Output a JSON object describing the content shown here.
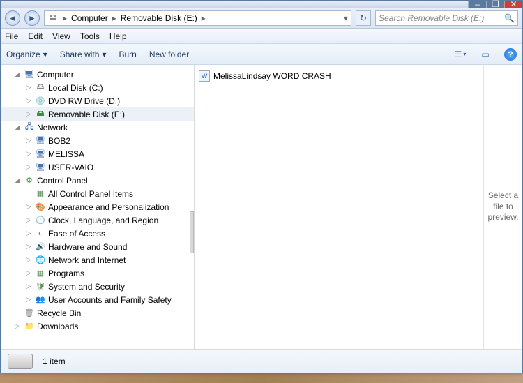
{
  "title_controls": {
    "min": "–",
    "max": "❐",
    "close": "✕"
  },
  "nav": {
    "back": "◄",
    "fwd": "►",
    "refresh": "↻"
  },
  "breadcrumb": {
    "root": "Computer",
    "loc": "Removable Disk (E:)",
    "drive_icon": "🖴"
  },
  "search": {
    "placeholder": "Search Removable Disk (E:)",
    "icon": "🔍"
  },
  "menu": [
    "File",
    "Edit",
    "View",
    "Tools",
    "Help"
  ],
  "toolbar": {
    "organize": "Organize",
    "share": "Share with",
    "burn": "Burn",
    "newfolder": "New folder",
    "dd": "▾",
    "views": "☰",
    "pane": "▭",
    "help": "?"
  },
  "tree": [
    {
      "lvl": 1,
      "exp": "◢",
      "icon": "🖥",
      "cls": "i-computer",
      "label": "Computer"
    },
    {
      "lvl": 2,
      "exp": "▷",
      "icon": "🖴",
      "cls": "i-disk",
      "label": "Local Disk (C:)"
    },
    {
      "lvl": 2,
      "exp": "▷",
      "icon": "💿",
      "cls": "i-dvd",
      "label": "DVD RW Drive (D:)"
    },
    {
      "lvl": 2,
      "exp": "▷",
      "icon": "🖴",
      "cls": "i-remov",
      "label": "Removable Disk (E:)",
      "sel": true
    },
    {
      "lvl": 1,
      "exp": "◢",
      "icon": "🖧",
      "cls": "i-net",
      "label": "Network"
    },
    {
      "lvl": 2,
      "exp": "▷",
      "icon": "🖥",
      "cls": "i-pc",
      "label": "BOB2"
    },
    {
      "lvl": 2,
      "exp": "▷",
      "icon": "🖥",
      "cls": "i-pc",
      "label": "MELISSA"
    },
    {
      "lvl": 2,
      "exp": "▷",
      "icon": "🖥",
      "cls": "i-pc",
      "label": "USER-VAIO"
    },
    {
      "lvl": 1,
      "exp": "◢",
      "icon": "⚙",
      "cls": "i-cp",
      "label": "Control Panel"
    },
    {
      "lvl": 2,
      "exp": "",
      "icon": "▦",
      "cls": "i-cpi",
      "label": "All Control Panel Items"
    },
    {
      "lvl": 2,
      "exp": "▷",
      "icon": "🎨",
      "cls": "i-cpi",
      "label": "Appearance and Personalization"
    },
    {
      "lvl": 2,
      "exp": "▷",
      "icon": "🕒",
      "cls": "i-cpi",
      "label": "Clock, Language, and Region"
    },
    {
      "lvl": 2,
      "exp": "▷",
      "icon": "◐",
      "cls": "i-cpi",
      "label": "Ease of Access"
    },
    {
      "lvl": 2,
      "exp": "▷",
      "icon": "🔊",
      "cls": "i-cpi",
      "label": "Hardware and Sound"
    },
    {
      "lvl": 2,
      "exp": "▷",
      "icon": "🌐",
      "cls": "i-cpi",
      "label": "Network and Internet"
    },
    {
      "lvl": 2,
      "exp": "▷",
      "icon": "▦",
      "cls": "i-cpi",
      "label": "Programs"
    },
    {
      "lvl": 2,
      "exp": "▷",
      "icon": "🛡",
      "cls": "i-cpi",
      "label": "System and Security"
    },
    {
      "lvl": 2,
      "exp": "▷",
      "icon": "👥",
      "cls": "i-cpi",
      "label": "User Accounts and Family Safety"
    },
    {
      "lvl": 1,
      "exp": "",
      "icon": "🗑",
      "cls": "i-bin",
      "label": "Recycle Bin"
    },
    {
      "lvl": 1,
      "exp": "▷",
      "icon": "📁",
      "cls": "i-dl",
      "label": "Downloads"
    }
  ],
  "files": [
    {
      "icon": "W",
      "name": "MelissaLindsay WORD CRASH"
    }
  ],
  "preview_text": "Select a file to preview.",
  "status": {
    "count": "1 item"
  }
}
